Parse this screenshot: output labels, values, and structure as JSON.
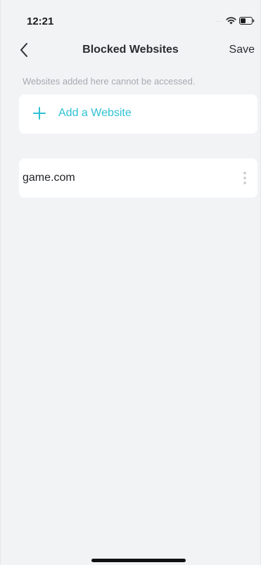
{
  "status_bar": {
    "time": "12:21",
    "signal_dots": "....",
    "icons": [
      "wifi-icon",
      "battery-icon"
    ]
  },
  "nav": {
    "back_icon": "chevron-left-icon",
    "title": "Blocked Websites",
    "save_label": "Save"
  },
  "hint": "Websites added here cannot be accessed.",
  "add_website": {
    "icon": "plus-icon",
    "label": "Add a Website"
  },
  "websites": [
    {
      "name": "game.com",
      "menu_icon": "more-vertical-icon"
    }
  ],
  "colors": {
    "background": "#f2f3f5",
    "card": "#ffffff",
    "accent": "#2ec1d4",
    "text_primary": "#2b2d31",
    "text_muted": "#a7aab0"
  }
}
